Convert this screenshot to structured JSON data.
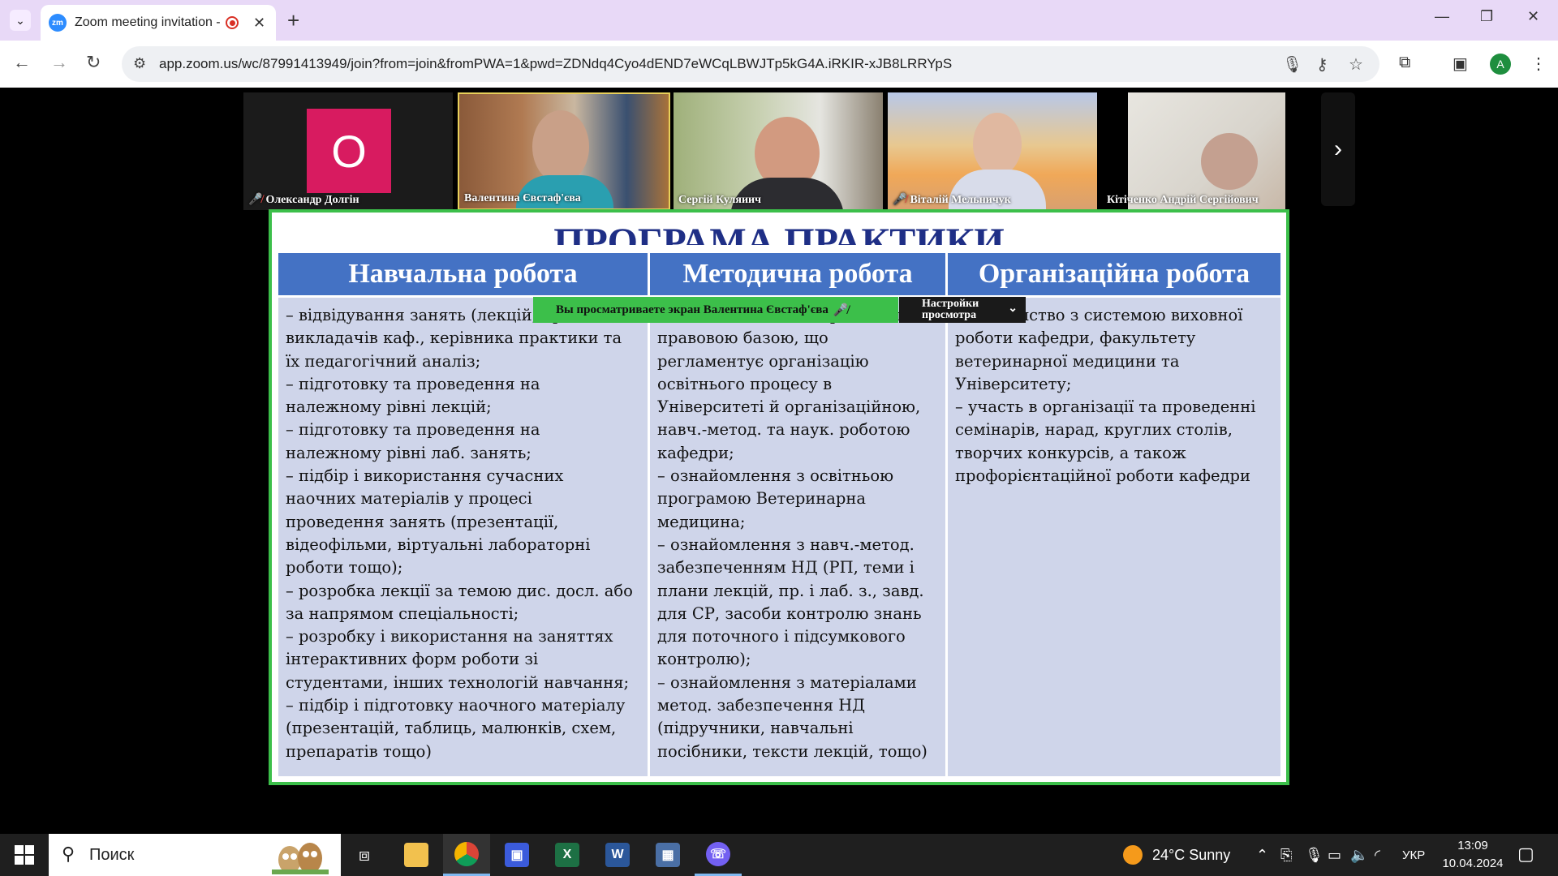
{
  "browser": {
    "tab_title": "Zoom meeting invitation - Z",
    "favicon_text": "zm",
    "url": "app.zoom.us/wc/87991413949/join?from=join&fromPWA=1&pwd=ZDNdq4Cyo4dEND7eWCqLBWJTp5kG4A.iRKIR-xJB8LRRYpS",
    "profile_initial": "A"
  },
  "participants": [
    {
      "name": "Олександр Долгін",
      "initial": "О",
      "muted": true
    },
    {
      "name": "Валентина Євстаф'єва",
      "muted": false
    },
    {
      "name": "Сергій Куляиич",
      "muted": false
    },
    {
      "name": "Віталій Мельничук",
      "muted": true
    },
    {
      "name": "Кітіченко Андрій Сергійович",
      "muted": false
    }
  ],
  "share": {
    "banner": "Вы просматриваете экран  Валентина Євстаф'єва",
    "view_settings": "Настройки просмотра",
    "slide_title": "ПРОГРАМА ПРАКТИКИ",
    "columns": [
      {
        "header": "Навчальна робота",
        "body": "– відвідування занять (лекцій, пр., лаб.)\nвикладачів каф., керівника практики та\nїх педагогічний аналіз;\n– підготовку та проведення на\nналежному рівні лекцій;\n– підготовку та проведення на\nналежному рівні лаб. занять;\n– підбір і використання сучасних\nнаочних матеріалів у процесі\nпроведення занять (презентації,\nвідеофільми, віртуальні лабораторні\nроботи тощо);\n– розробка лекції за темою дис. досл. або\nза напрямом спеціальності;\n– розробку і використання на заняттях\nінтерактивних форм роботи зі\nстудентами, інших технологій навчання;\n– підбір і підготовку наочного матеріалу\n(презентацій, таблиць, малюнків, схем,\nпрепаратів тощо)"
      },
      {
        "header": "Методична робота",
        "body": "– ознайомлення з нормативно-\nправовою базою, що\nрегламентує організацію\nосвітнього процесу в\nУніверситеті й організаційною,\nнавч.-метод. та наук. роботою\nкафедри;\n– ознайомлення з освітньою\nпрограмою Ветеринарна\nмедицина;\n– ознайомлення з навч.-метод.\nзабезпеченням НД (РП, теми і\nплани лекцій, пр. і лаб. з., завд.\nдля СР, засоби контролю знань\nдля поточного і підсумкового\nконтролю);\n– ознайомлення з матеріалами\nметод. забезпечення НД\n(підручники, навчальні\nпосібники, тексти лекцій, тощо)"
      },
      {
        "header": "Організаційна робота",
        "body": "– знайомство з системою виховної\nроботи кафедри, факультету\nветеринарної медицини та\nУніверситету;\n– участь в організації та проведенні\nсемінарів, нарад, круглих столів,\nтворчих конкурсів, а також\nпрофорієнтаційної роботи кафедри"
      }
    ]
  },
  "taskbar": {
    "search_placeholder": "Поиск",
    "weather": "24°C  Sunny",
    "language": "УКР",
    "time": "13:09",
    "date": "10.04.2024"
  },
  "colors": {
    "share_border": "#3cbf4a",
    "table_header": "#4472c4",
    "table_body": "#cfd5ea",
    "avatar": "#d81b60"
  }
}
